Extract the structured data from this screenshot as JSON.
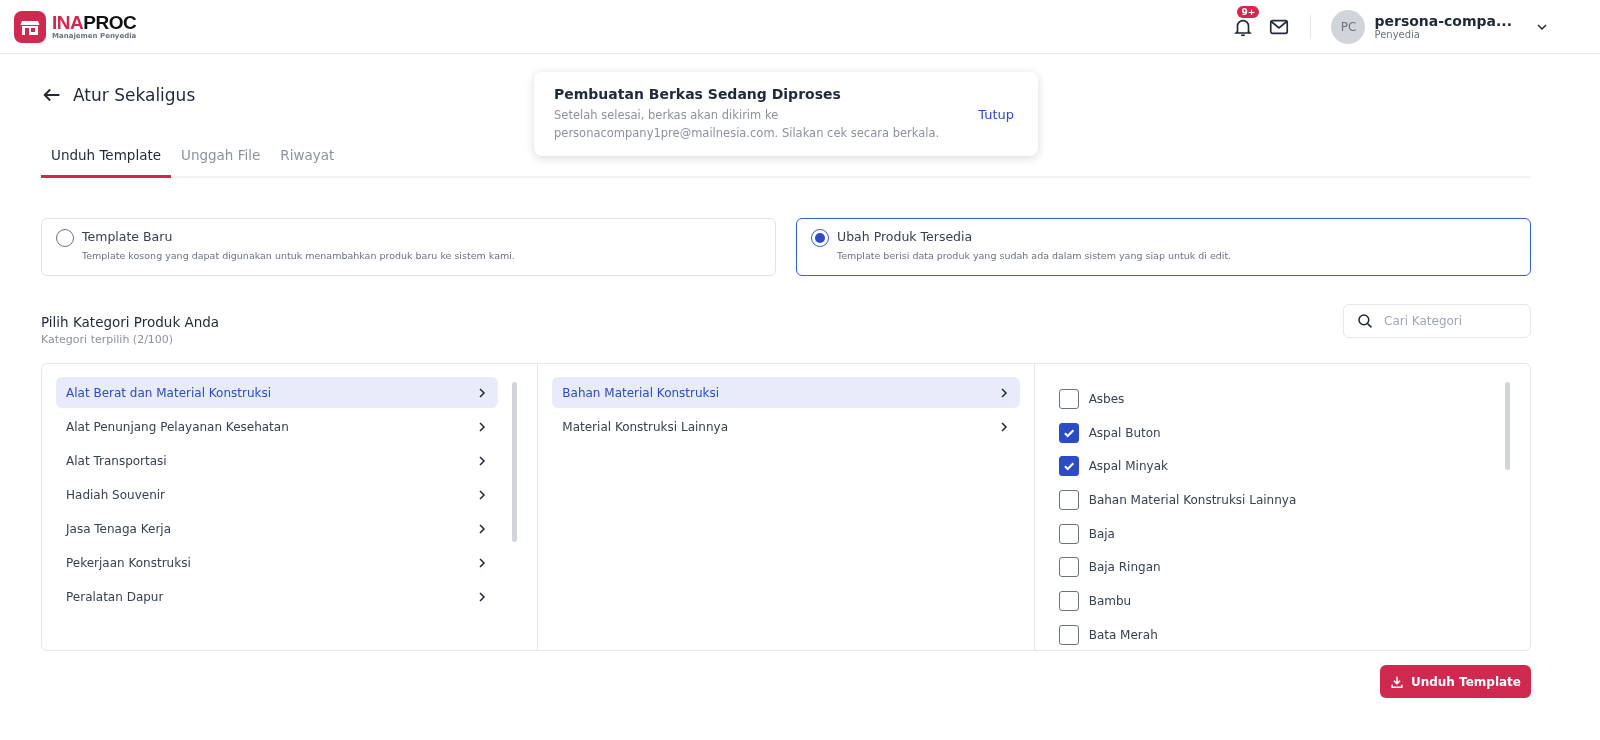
{
  "header": {
    "brand_lead": "INA",
    "brand_rest": "PROC",
    "brand_subtitle": "Manajemen Penyedia",
    "notification_badge": "9+",
    "avatar_initials": "PC",
    "user_name": "persona-compa...",
    "user_role": "Penyedia"
  },
  "toast": {
    "title": "Pembuatan Berkas Sedang Diproses",
    "message": "Setelah selesai, berkas akan dikirim ke personacompany1pre@mailnesia.com. Silakan cek secara berkala.",
    "action": "Tutup"
  },
  "page_title": "Atur Sekaligus",
  "tabs": [
    {
      "label": "Unduh Template",
      "selected": true
    },
    {
      "label": "Unggah File",
      "selected": false
    },
    {
      "label": "Riwayat",
      "selected": false
    }
  ],
  "template_options": [
    {
      "title": "Template Baru",
      "description": "Template kosong yang dapat digunakan untuk menambahkan produk baru ke sistem kami.",
      "selected": false
    },
    {
      "title": "Ubah Produk Tersedia",
      "description": "Template berisi data produk yang sudah ada dalam sistem yang siap untuk di edit.",
      "selected": true
    }
  ],
  "category_section": {
    "title": "Pilih Kategori Produk Anda",
    "subtitle": "Kategori terpilih (2/100)",
    "search": {
      "placeholder": "Cari Kategori"
    }
  },
  "categories_level_1": [
    {
      "label": "Alat Berat dan Material Konstruksi",
      "selected": true
    },
    {
      "label": "Alat Penunjang Pelayanan Kesehatan",
      "selected": false
    },
    {
      "label": "Alat Transportasi",
      "selected": false
    },
    {
      "label": "Hadiah Souvenir",
      "selected": false
    },
    {
      "label": "Jasa Tenaga Kerja",
      "selected": false
    },
    {
      "label": "Pekerjaan Konstruksi",
      "selected": false
    },
    {
      "label": "Peralatan Dapur",
      "selected": false
    }
  ],
  "categories_level_2": [
    {
      "label": "Bahan Material Konstruksi",
      "selected": true
    },
    {
      "label": "Material Konstruksi Lainnya",
      "selected": false
    }
  ],
  "categories_level_3": [
    {
      "label": "Asbes",
      "checked": false
    },
    {
      "label": "Aspal Buton",
      "checked": true
    },
    {
      "label": "Aspal Minyak",
      "checked": true
    },
    {
      "label": "Bahan Material Konstruksi Lainnya",
      "checked": false
    },
    {
      "label": "Baja",
      "checked": false
    },
    {
      "label": "Baja Ringan",
      "checked": false
    },
    {
      "label": "Bambu",
      "checked": false
    },
    {
      "label": "Bata Merah",
      "checked": false
    }
  ],
  "download_button": "Unduh Template"
}
